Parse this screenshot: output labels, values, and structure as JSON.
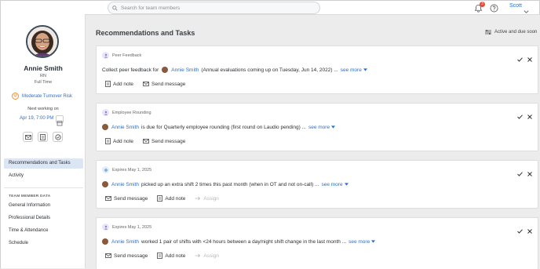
{
  "topbar": {
    "search_placeholder": "Search for team members",
    "notification_count": "3",
    "user_name": "Scott"
  },
  "profile": {
    "name": "Annie Smith",
    "role": "RN",
    "shift": "Full Time",
    "risk_badge": "M",
    "risk_label": "Moderate Turnover Risk",
    "next_label": "Next working on",
    "next_date": "Apr 19, 7:00 PM"
  },
  "nav": {
    "selected": "Recommendations and Tasks",
    "activity": "Activity",
    "section_header": "TEAM MEMBER DATA",
    "items": [
      "General Information",
      "Professional Details",
      "Time & Attendance",
      "Schedule"
    ]
  },
  "main": {
    "title": "Recommendations and Tasks",
    "filter_label": "Active and due soon"
  },
  "cards": [
    {
      "type": "Peer Feedback",
      "pre": "Collect peer feedback for",
      "name": "Annie Smith",
      "post": "(Annual evaluations coming up on Tuesday, Jun 14, 2022) ...",
      "see_more": "see more",
      "actions": [
        "Add note",
        "Send message"
      ]
    },
    {
      "type": "Employee Rounding",
      "pre": "",
      "name": "Annie Smith",
      "post": "is due for Quarterly employee rounding (first round on Laudio pending) ...",
      "see_more": "see more",
      "actions": [
        "Add note",
        "Send message"
      ]
    },
    {
      "type": "Expires May 1, 2025",
      "pre": "",
      "name": "Annie Smith",
      "post": "picked up an extra shift 2 times this past month (when in OT and not on-call) ...",
      "see_more": "see more",
      "actions": [
        "Send message",
        "Add note",
        "Assign"
      ]
    },
    {
      "type": "Expires May 1, 2025",
      "pre": "",
      "name": "Annie Smith",
      "post": "worked 1 pair of shifts with <24 hours between a day/night shift change in the last month ...",
      "see_more": "see more",
      "actions": [
        "Send message",
        "Add note",
        "Assign"
      ]
    }
  ],
  "colors": {
    "accent": "#2c6ecb",
    "badge": "#e5493a",
    "risk": "#e8923a",
    "nav_selected": "#dbe5f3"
  }
}
